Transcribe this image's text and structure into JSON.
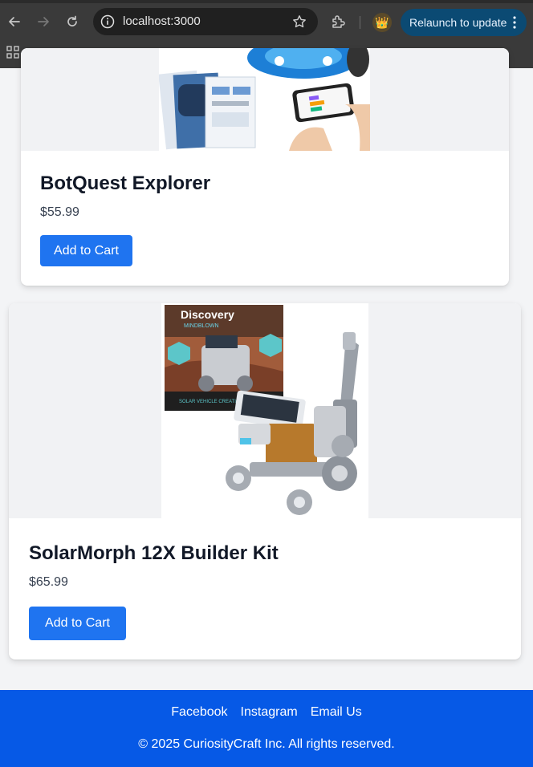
{
  "browser": {
    "url": "localhost:3000",
    "relaunch_label": "Relaunch to update",
    "profile_emoji": "👑"
  },
  "products": [
    {
      "name": "BotQuest Explorer",
      "price": "$55.99",
      "cta": "Add to Cart"
    },
    {
      "name": "SolarMorph 12X Builder Kit",
      "price": "$65.99",
      "cta": "Add to Cart"
    }
  ],
  "product_image_text": {
    "brand": "Discovery",
    "sub_brand": "MINDBLOWN",
    "box_caption": "SOLAR VEHICLE CREATIONS"
  },
  "footer": {
    "links": [
      "Facebook",
      "Instagram",
      "Email Us"
    ],
    "copyright": "© 2025 CuriosityCraft Inc. All rights reserved."
  },
  "colors": {
    "primary": "#1f74f0",
    "footer_bg": "#0659e6",
    "page_bg": "#f3f4f6"
  }
}
